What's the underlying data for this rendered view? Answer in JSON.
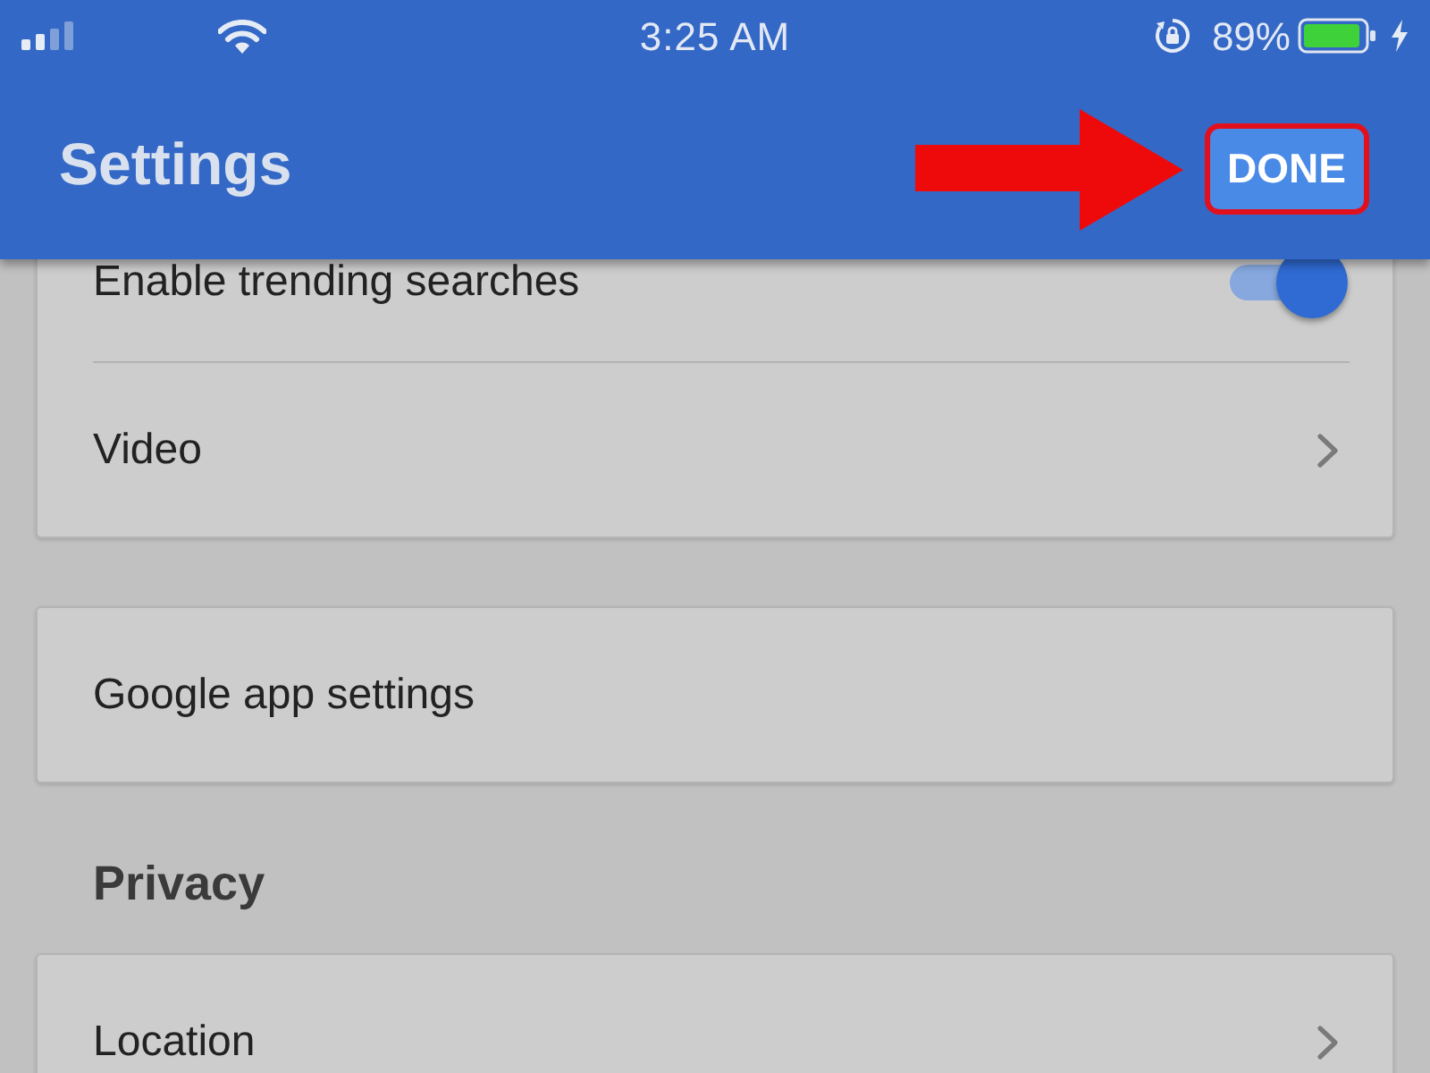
{
  "status_bar": {
    "time": "3:25 AM",
    "battery": "89%"
  },
  "header": {
    "title": "Settings",
    "done_button": "DONE"
  },
  "groups": [
    {
      "rows": [
        {
          "kind": "toggle",
          "label": "Enable trending searches",
          "on": true
        },
        {
          "kind": "link",
          "label": "Video"
        }
      ]
    },
    {
      "rows": [
        {
          "kind": "action",
          "label": "Google app settings"
        }
      ]
    },
    {
      "heading": "Privacy",
      "rows": [
        {
          "kind": "link",
          "label": "Location"
        }
      ]
    }
  ]
}
